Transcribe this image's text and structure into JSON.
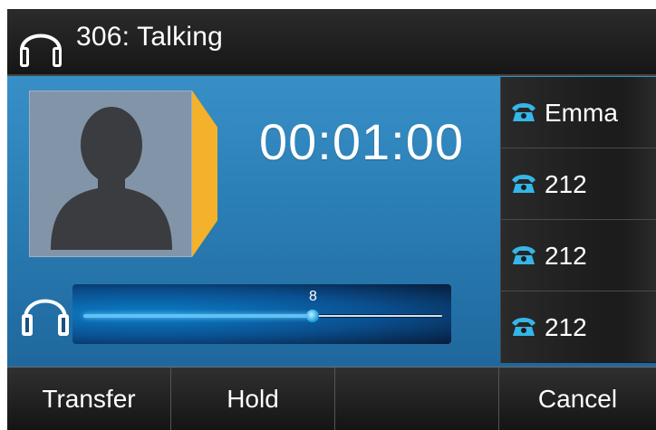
{
  "topbar": {
    "title": "306: Talking",
    "icon": "headset-icon"
  },
  "call": {
    "timer": "00:01:00"
  },
  "volume": {
    "level_label": "8",
    "level_fraction": 0.64
  },
  "lines": [
    {
      "label": "Emma",
      "icon": "phone-icon"
    },
    {
      "label": "212",
      "icon": "phone-icon"
    },
    {
      "label": "212",
      "icon": "phone-icon"
    },
    {
      "label": "212",
      "icon": "phone-icon"
    }
  ],
  "softkeys": [
    {
      "label": "Transfer"
    },
    {
      "label": "Hold"
    },
    {
      "label": ""
    },
    {
      "label": "Cancel"
    }
  ],
  "colors": {
    "accent": "#f4b12b",
    "screen": "#2b7fb7",
    "icon_blue": "#35b6e8"
  }
}
